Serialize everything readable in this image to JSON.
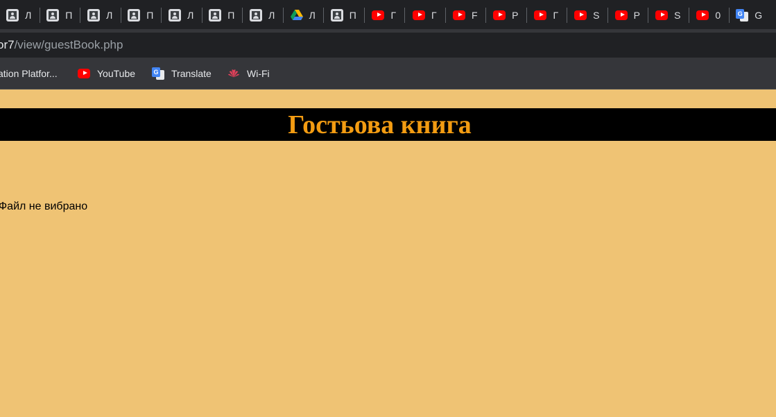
{
  "tabs": [
    {
      "icon": "account-icon",
      "label": "Л"
    },
    {
      "icon": "account-icon",
      "label": "П"
    },
    {
      "icon": "account-icon",
      "label": "Л"
    },
    {
      "icon": "account-icon",
      "label": "П"
    },
    {
      "icon": "account-icon",
      "label": "Л"
    },
    {
      "icon": "account-icon",
      "label": "П"
    },
    {
      "icon": "account-icon",
      "label": "Л"
    },
    {
      "icon": "google-drive-icon",
      "label": "Л"
    },
    {
      "icon": "account-icon",
      "label": "П"
    },
    {
      "icon": "youtube-icon",
      "label": "Г"
    },
    {
      "icon": "youtube-icon",
      "label": "Г"
    },
    {
      "icon": "youtube-icon",
      "label": "F"
    },
    {
      "icon": "youtube-icon",
      "label": "Р"
    },
    {
      "icon": "youtube-icon",
      "label": "Г"
    },
    {
      "icon": "youtube-icon",
      "label": "S"
    },
    {
      "icon": "youtube-icon",
      "label": "Р"
    },
    {
      "icon": "youtube-icon",
      "label": "S"
    },
    {
      "icon": "youtube-icon",
      "label": "0"
    },
    {
      "icon": "google-translate-icon",
      "label": "G"
    }
  ],
  "address_bar": {
    "host": "or7",
    "path": "/view/guestBook.php"
  },
  "bookmarks": [
    {
      "icon": "",
      "label": "ation Platfor..."
    },
    {
      "icon": "youtube-icon",
      "label": "YouTube"
    },
    {
      "icon": "google-translate-icon",
      "label": "Translate"
    },
    {
      "icon": "huawei-icon",
      "label": "Wi-Fi"
    }
  ],
  "page": {
    "title": "Гостьова книга",
    "file_status": "Файл не вибрано"
  },
  "colors": {
    "page_background": "#efc374",
    "title_color": "#f39c12",
    "banner_background": "#000000"
  }
}
